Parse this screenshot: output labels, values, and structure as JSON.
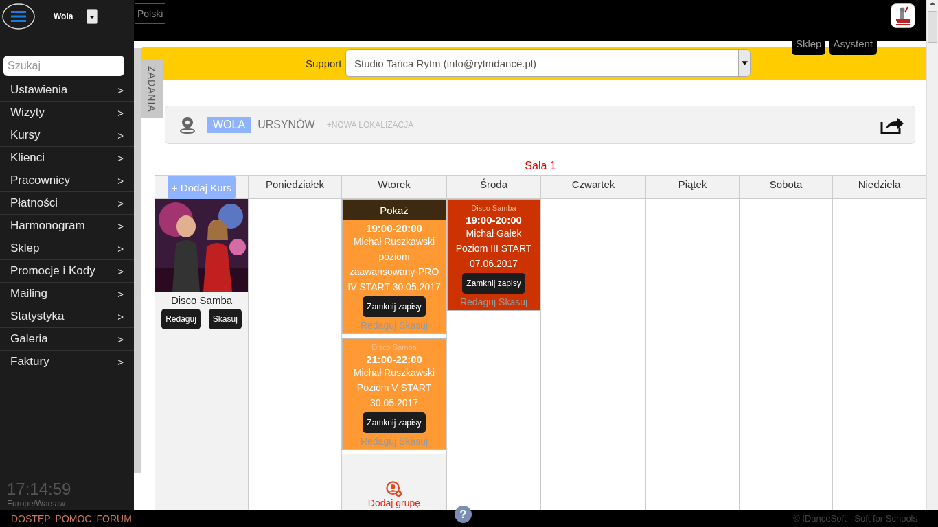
{
  "sidebar": {
    "location": "Wola",
    "search_placeholder": "Szukaj",
    "items": [
      {
        "label": "Ustawienia",
        "arrow": ">"
      },
      {
        "label": "Wizyty",
        "arrow": ">"
      },
      {
        "label": "Kursy",
        "arrow": ">"
      },
      {
        "label": "Klienci",
        "arrow": ">"
      },
      {
        "label": "Pracownicy",
        "arrow": ">"
      },
      {
        "label": "Płatności",
        "arrow": ">"
      },
      {
        "label": "Harmonogram",
        "arrow": ">"
      },
      {
        "label": "Sklep",
        "arrow": ">"
      },
      {
        "label": "Promocje i Kody",
        "arrow": ">"
      },
      {
        "label": "Mailing",
        "arrow": ">"
      },
      {
        "label": "Statystyka",
        "arrow": ">"
      },
      {
        "label": "Galeria",
        "arrow": ">"
      },
      {
        "label": "Faktury",
        "arrow": ">"
      }
    ],
    "clock": "17:14:59",
    "timezone": "Europe/Warsaw"
  },
  "top_bar": {
    "language": "Polski",
    "buttons": [
      "Sklep",
      "Asystent"
    ]
  },
  "support": {
    "label": "Support",
    "value": "Studio Tańca Rytm (info@rytmdance.pl)"
  },
  "side_tab": "ZADANIA",
  "locations": {
    "items": [
      {
        "label": "WOLA",
        "selected": true
      },
      {
        "label": "URSYNÓW",
        "selected": false
      }
    ],
    "add": "+NOWA LOKALIZACJA"
  },
  "schedule": {
    "title": "Sala 1",
    "add_course": "+ Dodaj Kurs",
    "course": {
      "kind": "picture",
      "name": "Disco Samba",
      "buttons": [
        "Redaguj",
        "Skasuj"
      ]
    },
    "days": [
      {
        "name": "Poniedziałek"
      },
      {
        "name": "Wtorek",
        "events": [
          {
            "color": "#ff9933",
            "overlay": "Pokaż",
            "time": "19:00-20:00",
            "details": "Michał Ruszkawski poziom zaawansowany-PRO IV START 30.05.2017",
            "button": "Zamknij zapisy",
            "links": [
              "Redaguj",
              "Skasuj"
            ]
          },
          {
            "color": "#ff9933",
            "course": "Disco Samba",
            "time": "21:00-22:00",
            "details": "Michał Ruszkawski Poziom V START 30.05.2017",
            "button": "Zamknij zapisy",
            "links": [
              "Redaguj",
              "Skasuj"
            ]
          }
        ],
        "add_group": "Dodaj grupę"
      },
      {
        "name": "Środa",
        "events": [
          {
            "color": "#cc3300",
            "course": "Disco Samba",
            "time": "19:00-20:00",
            "details": "Michał Gałek Poziom III START 07.06.2017",
            "button": "Zamknij zapisy",
            "links": [
              "Redaguj",
              "Skasuj"
            ]
          }
        ]
      },
      {
        "name": "Czwartek"
      },
      {
        "name": "Piątek"
      },
      {
        "name": "Sobota"
      },
      {
        "name": "Niedziela"
      }
    ]
  },
  "footer": {
    "links": [
      "DOSTĘP",
      "POMOC",
      "FORUM"
    ],
    "help": "?",
    "copyright": "© IDanceSoft - Soft for Schools"
  }
}
